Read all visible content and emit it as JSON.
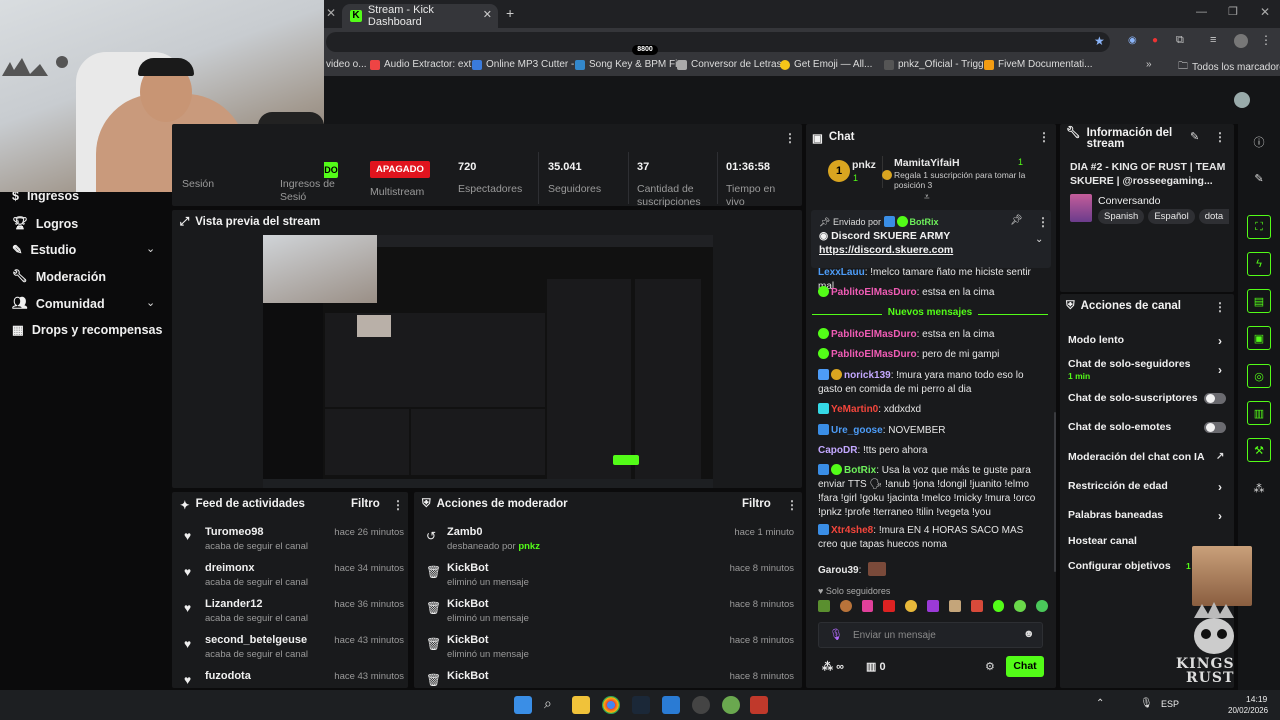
{
  "browser": {
    "tabs": [
      {
        "label": "Stream - Kick Dashboard"
      }
    ],
    "bookmarks": [
      "video o...",
      "Audio Extractor: ext...",
      "Online MP3 Cutter -...",
      "Song Key & BPM Fi...",
      "Conversor de Letras...",
      "Get Emoji — All...",
      "pnkz_Oficial - Trigg...",
      "FiveM Documentati..."
    ],
    "bookmarks_folder": "Todos los marcadores",
    "center_label": "8800"
  },
  "nav": {
    "items": [
      {
        "label": "Ingresos",
        "icon": "dollar-icon"
      },
      {
        "label": "Logros",
        "icon": "trophy-icon"
      },
      {
        "label": "Estudio",
        "icon": "studio-icon",
        "expandable": true
      },
      {
        "label": "Moderación",
        "icon": "wrench-icon"
      },
      {
        "label": "Comunidad",
        "icon": "community-icon",
        "expandable": true
      },
      {
        "label": "Drops y recompensas",
        "icon": "drops-icon"
      }
    ]
  },
  "stats": {
    "live_badge": "DO",
    "session_label": "Sesión",
    "income_label": "Ingresos de Sesió",
    "multistream_badge": "APAGADO",
    "multistream_label": "Multistream",
    "viewers_value": "720",
    "viewers_label": "Espectadores",
    "followers_value": "35.041",
    "followers_label": "Seguidores",
    "subs_value": "37",
    "subs_label": "Cantidad de suscripciones",
    "time_value": "01:36:58",
    "time_label": "Tiempo en vivo"
  },
  "preview": {
    "title": "Vista previa del stream"
  },
  "feed": {
    "title": "Feed de actividades",
    "filter_label": "Filtro",
    "rows": [
      {
        "name": "Turomeo98",
        "sub": "acaba de seguir el canal",
        "time": "hace 26 minutos"
      },
      {
        "name": "dreimonx",
        "sub": "acaba de seguir el canal",
        "time": "hace 34 minutos"
      },
      {
        "name": "Lizander12",
        "sub": "acaba de seguir el canal",
        "time": "hace 36 minutos"
      },
      {
        "name": "second_betelgeuse",
        "sub": "acaba de seguir el canal",
        "time": "hace 43 minutos"
      },
      {
        "name": "fuzodota",
        "sub": "",
        "time": "hace 43 minutos"
      }
    ]
  },
  "modactions": {
    "title": "Acciones de moderador",
    "filter_label": "Filtro",
    "rows": [
      {
        "name": "Zamb0",
        "sub": "desbaneado por",
        "sub_user": "pnkz",
        "time": "hace 1 minuto",
        "icon": "undo-icon"
      },
      {
        "name": "KickBot",
        "sub": "eliminó un mensaje",
        "sub_user": "",
        "time": "hace 8 minutos",
        "icon": "trash-icon"
      },
      {
        "name": "KickBot",
        "sub": "eliminó un mensaje",
        "sub_user": "",
        "time": "hace 8 minutos",
        "icon": "trash-icon"
      },
      {
        "name": "KickBot",
        "sub": "eliminó un mensaje",
        "sub_user": "",
        "time": "hace 8 minutos",
        "icon": "trash-icon"
      },
      {
        "name": "KickBot",
        "sub": "",
        "sub_user": "",
        "time": "hace 8 minutos",
        "icon": "trash-icon"
      }
    ]
  },
  "chat": {
    "title": "Chat",
    "top_user1": "pnkz",
    "top_user1_count": "1",
    "top_user2": "MamitaYifaiH",
    "top_user2_count": "1",
    "top_user2_note": "Regala 1 suscripción para tomar la posición 3",
    "pinned_by_label": "Enviado por",
    "pinned_by_user": "BotRix",
    "pinned_text": "Discord SKUERE ARMY",
    "pinned_link": "https://discord.skuere.com",
    "new_messages_label": "Nuevos mensajes",
    "messages": [
      {
        "user": "LexxLauu",
        "text": "!melco tamare ñato me hiciste sentir mal",
        "cls": "u-blue"
      },
      {
        "user": "PablitoElMasDuro",
        "text": "estsa en la cima",
        "cls": "u-pink"
      },
      {
        "user": "PablitoElMasDuro",
        "text": "estsa en la cima",
        "cls": "u-pink"
      },
      {
        "user": "PablitoElMasDuro",
        "text": "pero de mi gampi",
        "cls": "u-pink"
      },
      {
        "user": "norick139",
        "text": "!mura yara mano todo eso lo gasto en comida de mi perro al dia",
        "cls": "u-lav"
      },
      {
        "user": "YeMartin0",
        "text": "xddxdxd",
        "cls": "u-red"
      },
      {
        "user": "Ure_goose",
        "text": "NOVEMBER",
        "cls": "u-blue"
      },
      {
        "user": "CapoDR",
        "text": "!tts pero ahora",
        "cls": "u-lav"
      },
      {
        "user": "BotRix",
        "text": "Usa la voz que más te guste para enviar TTS 🗣 !anub !jona !dongil !juanito !elmo !fara !girl !goku !jacinta !melco !micky !mura !orco !pnkz !profe !terraneo !tilin !vegeta !you",
        "cls": "u-green"
      },
      {
        "user": "Xtr4she8",
        "text": "!mura EN 4 HORAS SACO MAS creo que tapas huecos noma",
        "cls": "u-red"
      },
      {
        "user": "Garou39",
        "text": "",
        "cls": "u-plain"
      }
    ],
    "followers_only_label": "Solo seguidores",
    "input_placeholder": "Enviar un mensaje",
    "infinity_label": "∞",
    "box_count": "0",
    "send_label": "Chat"
  },
  "info": {
    "title": "Información del stream",
    "stream_title": "DIA #2 - KING OF RUST | TEAM SKUERE | @rosseegaming...",
    "category": "Conversando",
    "tags": [
      "Spanish",
      "Español",
      "dota"
    ]
  },
  "actions": {
    "title": "Acciones de canal",
    "rows": [
      {
        "label": "Modo lento",
        "kind": "chevron",
        "sub": ""
      },
      {
        "label": "Chat de solo-seguidores",
        "kind": "chevron",
        "sub": "1 min"
      },
      {
        "label": "Chat de solo-suscriptores",
        "kind": "toggle",
        "sub": ""
      },
      {
        "label": "Chat de solo-emotes",
        "kind": "toggle",
        "sub": ""
      },
      {
        "label": "Moderación del chat con IA",
        "kind": "external",
        "sub": ""
      },
      {
        "label": "Restricción de edad",
        "kind": "chevron",
        "sub": ""
      },
      {
        "label": "Palabras baneadas",
        "kind": "chevron",
        "sub": ""
      },
      {
        "label": "Hostear canal",
        "kind": "none",
        "sub": ""
      },
      {
        "label": "Configurar objetivos",
        "kind": "none",
        "sub": "1 a"
      }
    ]
  },
  "overlay": {
    "logo_line1": "KINGS",
    "logo_line2": "RUST"
  },
  "taskbar": {
    "lang": "ESP",
    "time": "14:19",
    "date": "20/02/2026"
  },
  "colors": {
    "accent": "#53fc18",
    "panel": "#191a1c",
    "bg": "#0b0b0c",
    "apagado": "#e0141e"
  }
}
